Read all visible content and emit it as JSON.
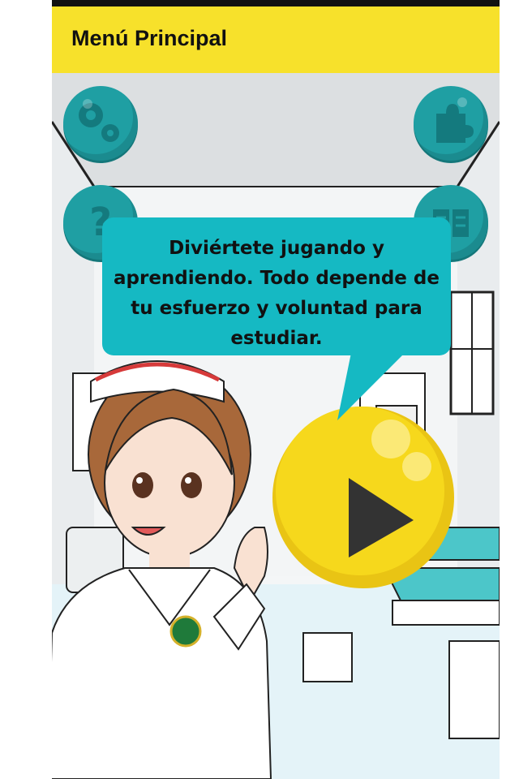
{
  "app": {
    "title": "Menú Principal"
  },
  "menu": {
    "settings_icon": "gears-icon",
    "puzzle_icon": "puzzle-icon",
    "help_icon": "question-icon",
    "book_icon": "book-icon"
  },
  "speech": {
    "message": "Diviértete jugando y aprendiendo. Todo depende de tu esfuerzo y voluntad para estudiar."
  },
  "play": {
    "icon": "play-icon"
  },
  "colors": {
    "appbar": "#f7e12b",
    "teal": "#1f9fa3",
    "bubble": "#15b9c3",
    "play": "#f6d81c"
  }
}
